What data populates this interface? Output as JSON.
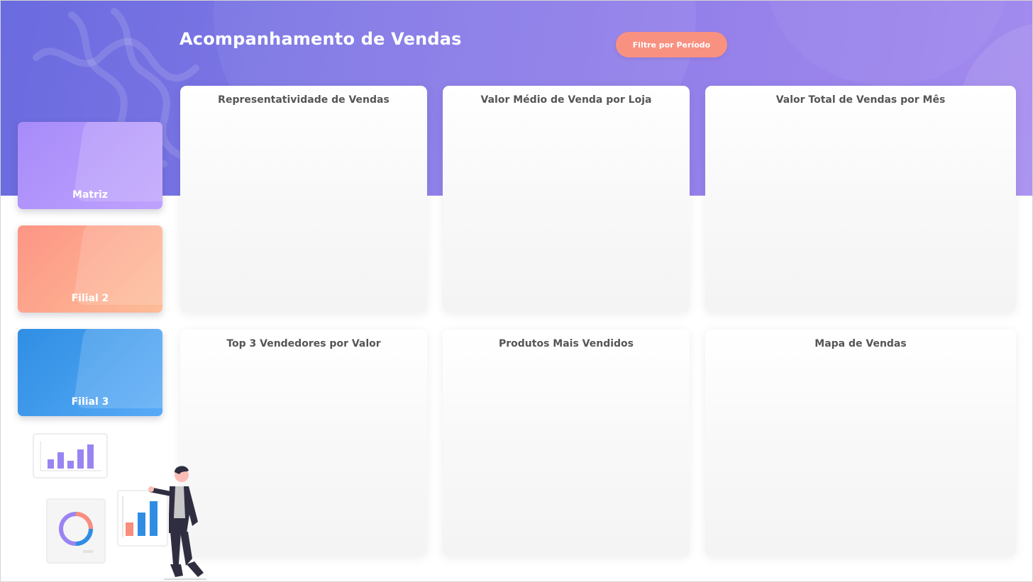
{
  "header": {
    "title": "Acompanhamento de Vendas",
    "filter_button_label": "Filtre por Período"
  },
  "stores": [
    {
      "label": "Matriz",
      "color": "#a78bfa"
    },
    {
      "label": "Filial 2",
      "color": "#fd9585"
    },
    {
      "label": "Filial 3",
      "color": "#2f8ee3"
    }
  ],
  "panels": [
    {
      "title": "Representatividade de Vendas"
    },
    {
      "title": "Valor Médio de Venda por Loja"
    },
    {
      "title": "Valor Total de Vendas por Mês"
    },
    {
      "title": "Top 3 Vendedores por Valor"
    },
    {
      "title": "Produtos Mais Vendidos"
    },
    {
      "title": "Mapa de Vendas"
    }
  ],
  "colors": {
    "header_gradient_start": "#6a6bdf",
    "header_gradient_end": "#a38bee",
    "accent_button": "#f99181",
    "panel_title_text": "#555555"
  },
  "icons": [
    "bar-chart-icon",
    "donut-chart-icon",
    "presenter-illustration"
  ]
}
